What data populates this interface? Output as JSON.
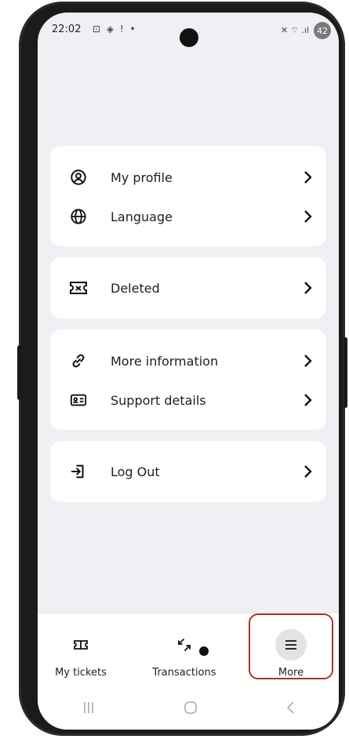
{
  "status_bar": {
    "time": "22:02",
    "left_icons": "⊡ ◈ ! •",
    "right_icons": "✕ ⌔ .ıl",
    "battery": "42"
  },
  "menu": {
    "group1": [
      {
        "label": "My profile",
        "icon": "profile-icon"
      },
      {
        "label": "Language",
        "icon": "globe-icon"
      }
    ],
    "group2": [
      {
        "label": "Deleted",
        "icon": "ticket-deleted-icon"
      }
    ],
    "group3": [
      {
        "label": "More information",
        "icon": "link-icon"
      },
      {
        "label": "Support details",
        "icon": "id-card-icon"
      }
    ],
    "group4": [
      {
        "label": "Log Out",
        "icon": "logout-icon"
      }
    ]
  },
  "bottom_nav": {
    "items": [
      {
        "label": "My tickets",
        "icon": "ticket-icon"
      },
      {
        "label": "Transactions",
        "icon": "arrows-icon"
      },
      {
        "label": "More",
        "icon": "hamburger-icon",
        "active": true
      }
    ]
  },
  "colors": {
    "highlight": "#b0312b",
    "screen_bg": "#eef0f3",
    "card_bg": "#ffffff"
  }
}
